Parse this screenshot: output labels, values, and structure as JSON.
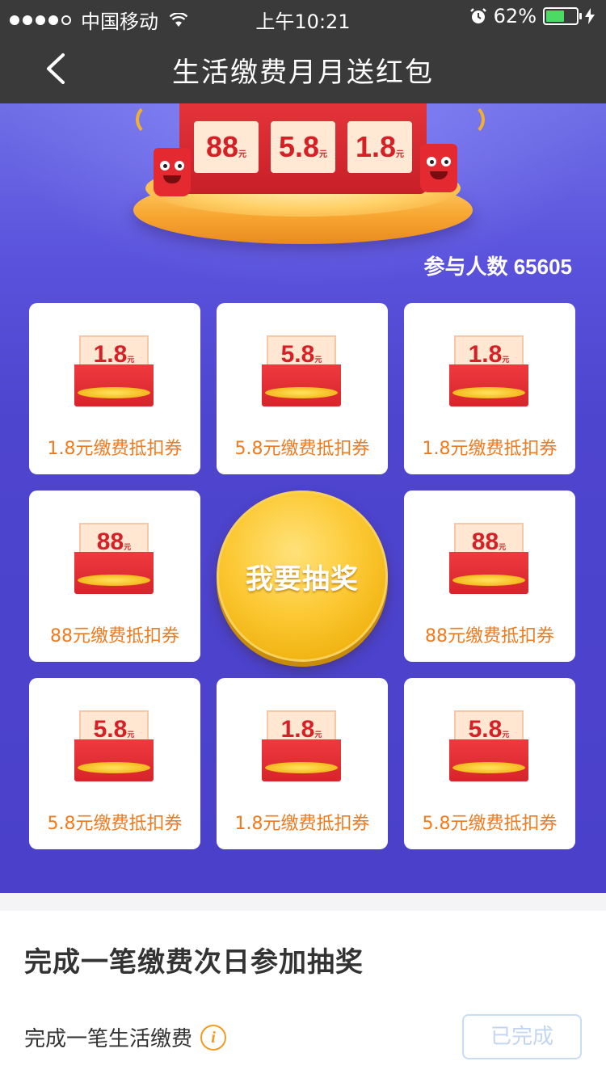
{
  "status_bar": {
    "carrier": "中国移动",
    "time": "上午10:21",
    "battery_percent": "62%",
    "battery_level": 0.62,
    "signal_bars_filled": 4,
    "signal_bars_total": 5
  },
  "nav": {
    "back_icon": "chevron-left-icon",
    "title": "生活缴费月月送红包"
  },
  "hero": {
    "prize_tiles": [
      "88",
      "5.8",
      "1.8"
    ],
    "tile_unit": "元",
    "participants": "参与人数 65605"
  },
  "grid": {
    "cells": [
      {
        "amount": "1.8",
        "unit": "元",
        "label": "1.8元缴费抵扣券"
      },
      {
        "amount": "5.8",
        "unit": "元",
        "label": "5.8元缴费抵扣券"
      },
      {
        "amount": "1.8",
        "unit": "元",
        "label": "1.8元缴费抵扣券"
      },
      {
        "amount": "88",
        "unit": "元",
        "label": "88元缴费抵扣券"
      },
      {
        "amount": "88",
        "unit": "元",
        "label": "88元缴费抵扣券"
      },
      {
        "amount": "5.8",
        "unit": "元",
        "label": "5.8元缴费抵扣券"
      },
      {
        "amount": "1.8",
        "unit": "元",
        "label": "1.8元缴费抵扣券"
      },
      {
        "amount": "5.8",
        "unit": "元",
        "label": "5.8元缴费抵扣券"
      }
    ],
    "draw_button": "我要抽奖"
  },
  "task": {
    "title": "完成一笔缴费次日参加抽奖",
    "item_label": "完成一笔生活缴费",
    "info_icon": "info-icon",
    "status_button": "已完成"
  },
  "colors": {
    "hero_bg": "#4e45cf",
    "accent_orange": "#f07a1e",
    "envelope_red": "#d7242b",
    "gold": "#fcc935"
  }
}
